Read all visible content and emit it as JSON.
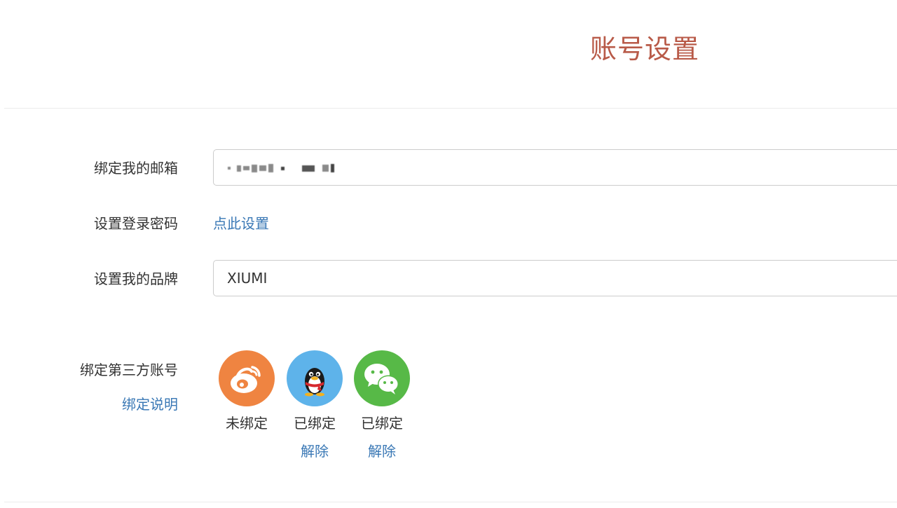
{
  "header": {
    "title": "账号设置"
  },
  "form": {
    "email": {
      "label": "绑定我的邮箱",
      "value": ""
    },
    "password": {
      "label": "设置登录密码",
      "action_label": "点此设置"
    },
    "brand": {
      "label": "设置我的品牌",
      "value": "XIUMI"
    },
    "third_party": {
      "label": "绑定第三方账号",
      "help_link": "绑定说明",
      "accounts": [
        {
          "icon": "weibo-icon",
          "color": "#ef8441",
          "status": "未绑定",
          "action": ""
        },
        {
          "icon": "qq-icon",
          "color": "#5eb3ea",
          "status": "已绑定",
          "action": "解除"
        },
        {
          "icon": "wechat-icon",
          "color": "#57b947",
          "status": "已绑定",
          "action": "解除"
        }
      ]
    }
  },
  "colors": {
    "title": "#b85a48",
    "link": "#3a78b5",
    "weibo": "#ef8441",
    "qq": "#5eb3ea",
    "wechat": "#57b947"
  }
}
